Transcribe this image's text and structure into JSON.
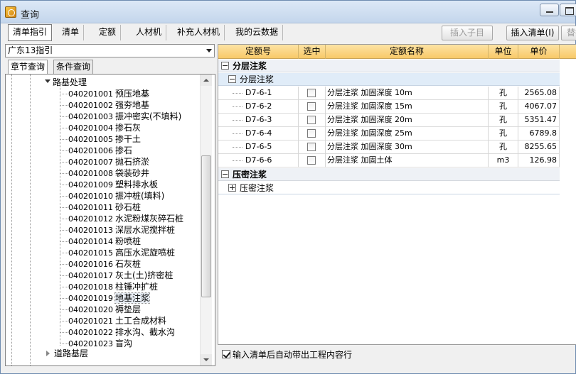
{
  "window": {
    "title": "查询"
  },
  "tabs": [
    {
      "label": "清单指引",
      "active": true
    },
    {
      "label": "清单",
      "active": false
    },
    {
      "label": "定额",
      "active": false
    },
    {
      "label": "人材机",
      "active": false
    },
    {
      "label": "补充人材机",
      "active": false
    },
    {
      "label": "我的云数据",
      "active": false
    }
  ],
  "toolbar": {
    "insert_child_label": "插入子目",
    "insert_list_label": "插入清单(I)",
    "replace_label": "替换"
  },
  "left_panel": {
    "combo_value": "广东13指引",
    "subtabs": [
      {
        "label": "章节查询",
        "active": true
      },
      {
        "label": "条件查询",
        "active": false
      }
    ],
    "tree": {
      "parent_label": "路基处理",
      "items": [
        {
          "code": "040201001",
          "name": "预压地基"
        },
        {
          "code": "040201002",
          "name": "强夯地基"
        },
        {
          "code": "040201003",
          "name": "振冲密实(不填料)"
        },
        {
          "code": "040201004",
          "name": "掺石灰"
        },
        {
          "code": "040201005",
          "name": "掺干土"
        },
        {
          "code": "040201006",
          "name": "掺石"
        },
        {
          "code": "040201007",
          "name": "抛石挤淤"
        },
        {
          "code": "040201008",
          "name": "袋装砂井"
        },
        {
          "code": "040201009",
          "name": "塑料排水板"
        },
        {
          "code": "040201010",
          "name": "振冲桩(填料)"
        },
        {
          "code": "040201011",
          "name": "砂石桩"
        },
        {
          "code": "040201012",
          "name": "水泥粉煤灰碎石桩"
        },
        {
          "code": "040201013",
          "name": "深层水泥搅拌桩"
        },
        {
          "code": "040201014",
          "name": "粉喷桩"
        },
        {
          "code": "040201015",
          "name": "高压水泥旋喷桩"
        },
        {
          "code": "040201016",
          "name": "石灰桩"
        },
        {
          "code": "040201017",
          "name": "灰土(土)挤密桩"
        },
        {
          "code": "040201018",
          "name": "柱锤冲扩桩"
        },
        {
          "code": "040201019",
          "name": "地基注浆",
          "selected": true
        },
        {
          "code": "040201020",
          "name": "褥垫层"
        },
        {
          "code": "040201021",
          "name": "土工合成材料"
        },
        {
          "code": "040201022",
          "name": "排水沟、截水沟"
        },
        {
          "code": "040201023",
          "name": "盲沟"
        }
      ],
      "next_label": "道路基层"
    }
  },
  "grid": {
    "columns": [
      "定额号",
      "选中",
      "定额名称",
      "单位",
      "单价"
    ],
    "groups": [
      {
        "label": "分层注浆",
        "subgroup": "分层注浆",
        "rows": [
          {
            "code": "D7-6-1",
            "name": "分层注浆 加固深度 10m",
            "unit": "孔",
            "price": "2565.08"
          },
          {
            "code": "D7-6-2",
            "name": "分层注浆 加固深度 15m",
            "unit": "孔",
            "price": "4067.07"
          },
          {
            "code": "D7-6-3",
            "name": "分层注浆 加固深度 20m",
            "unit": "孔",
            "price": "5351.47"
          },
          {
            "code": "D7-6-4",
            "name": "分层注浆 加固深度 25m",
            "unit": "孔",
            "price": "6789.8"
          },
          {
            "code": "D7-6-5",
            "name": "分层注浆 加固深度 30m",
            "unit": "孔",
            "price": "8255.65"
          },
          {
            "code": "D7-6-6",
            "name": "分层注浆 加固土体",
            "unit": "m3",
            "price": "126.98"
          }
        ]
      },
      {
        "label": "压密注浆",
        "subgroup": "压密注浆",
        "rows": []
      }
    ]
  },
  "footer": {
    "auto_bring_label": "输入清单后自动带出工程内容行",
    "auto_bring_checked": true
  }
}
